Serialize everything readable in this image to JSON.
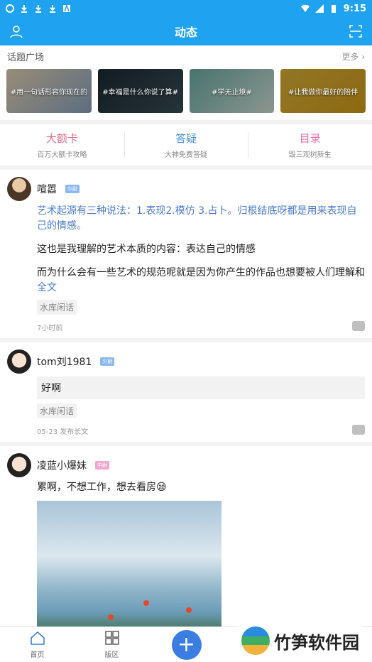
{
  "status": {
    "time": "9:15"
  },
  "header": {
    "title": "动态"
  },
  "topics": {
    "title": "话题广场",
    "more": "更多",
    "items": [
      {
        "label": "#用一句话形容你现在的"
      },
      {
        "label": "#幸福是什么你说了算#"
      },
      {
        "label": "#学无止境#"
      },
      {
        "label": "#让我做你最好的陪伴"
      }
    ]
  },
  "cats": [
    {
      "name": "大额卡",
      "sub": "百万大额卡攻略",
      "color": "#e36f8a"
    },
    {
      "name": "答疑",
      "sub": "大神免费答疑",
      "color": "#4a90d9"
    },
    {
      "name": "目录",
      "sub": "毁三观树新生",
      "color": "#e36fb0"
    }
  ],
  "posts": [
    {
      "user": "喧嚣",
      "lvl": "中尉",
      "p1": "艺术起源有三种说法：1.表现2.模仿 3.占卜。归根结底呀都是用来表现自己的情感。",
      "p2": "这也是我理解的艺术本质的内容：表达自己的情感",
      "p3": "而为什么会有一些艺术的规范呢就是因为你产生的作品也想要被人们理解和",
      "fulltext": "全文",
      "tag": "水库闲话",
      "meta": "7小时前"
    },
    {
      "user": "tom刘1981",
      "lvl": "少尉",
      "quote": "好啊",
      "tag": "水库闲话",
      "meta": "05-23  发布长文"
    },
    {
      "user": "凌蓝小爆妹",
      "lvl": "中尉",
      "text": "累啊，不想工作，想去看房😪"
    }
  ],
  "bottom": {
    "home": "首页",
    "board": "版区"
  },
  "watermark": {
    "text": "竹笋软件园"
  }
}
